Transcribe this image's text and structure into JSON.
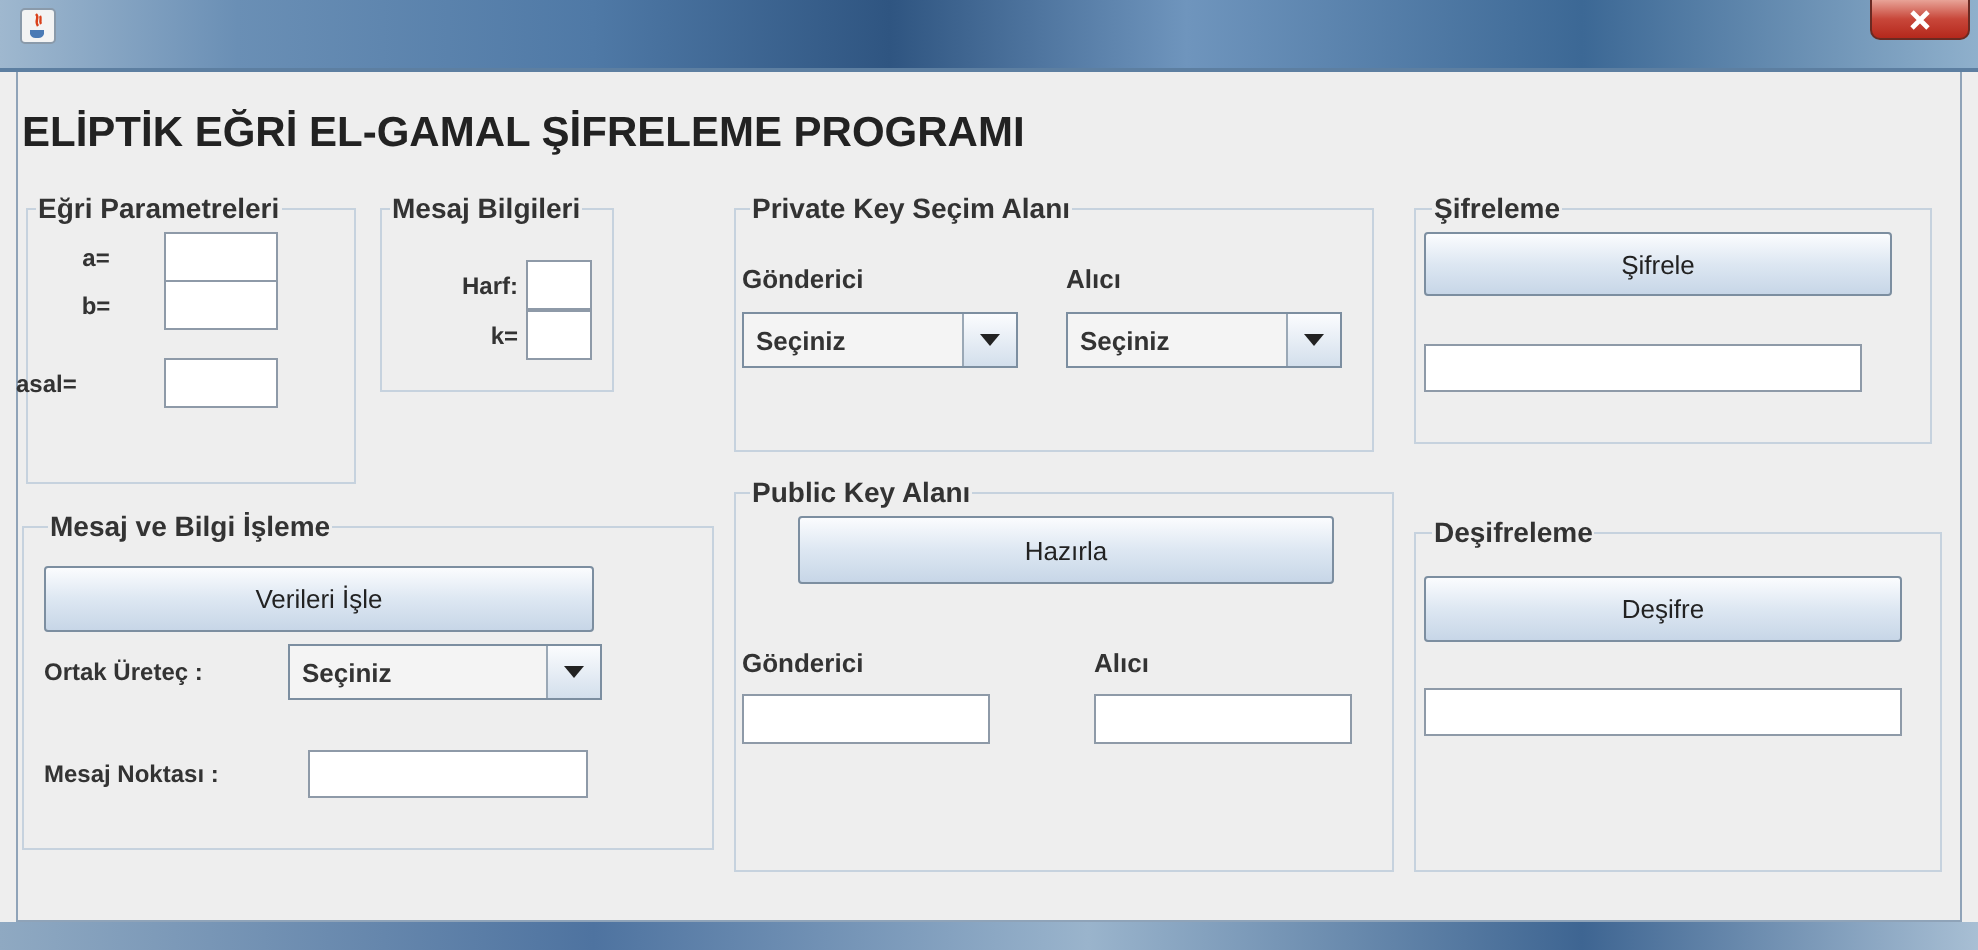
{
  "heading": "ELİPTİK EĞRİ EL-GAMAL ŞİFRELEME PROGRAMI",
  "curve_params": {
    "title": "Eğri Parametreleri",
    "fields": [
      {
        "label": "a="
      },
      {
        "label": "b="
      },
      {
        "label": "asal="
      }
    ]
  },
  "message_info": {
    "title": "Mesaj Bilgileri",
    "fields": [
      {
        "label": "Harf:"
      },
      {
        "label": "k="
      }
    ]
  },
  "processing": {
    "title": "Mesaj ve Bilgi İşleme",
    "button": "Verileri İşle",
    "generator_label": "Ortak Üreteç :",
    "generator_value": "Seçiniz",
    "point_label": "Mesaj Noktası :"
  },
  "private_key": {
    "title": "Private Key Seçim Alanı",
    "sender_label": "Gönderici",
    "sender_value": "Seçiniz",
    "receiver_label": "Alıcı",
    "receiver_value": "Seçiniz"
  },
  "public_key": {
    "title": "Public Key Alanı",
    "button": "Hazırla",
    "sender_label": "Gönderici",
    "receiver_label": "Alıcı"
  },
  "encryption": {
    "title": "Şifreleme",
    "button": "Şifrele"
  },
  "decryption": {
    "title": "Deşifreleme",
    "button": "Deşifre"
  }
}
